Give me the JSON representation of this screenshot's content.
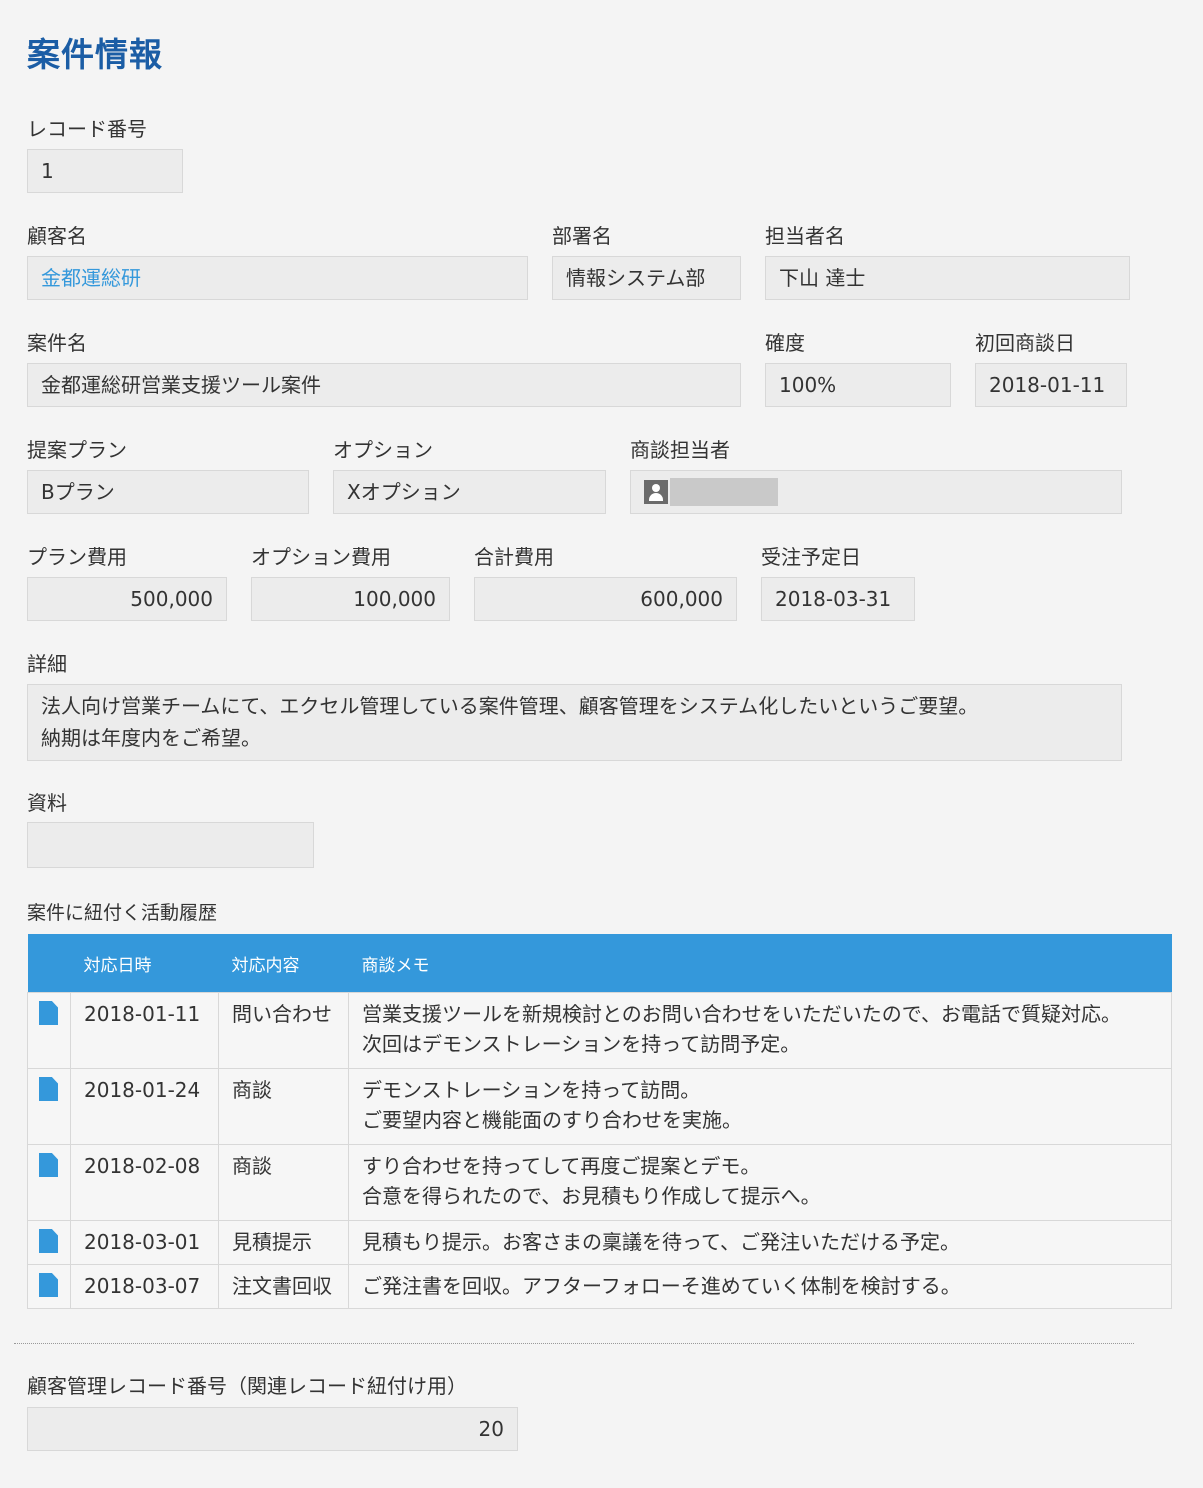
{
  "page_title": "案件情報",
  "record_number": {
    "label": "レコード番号",
    "value": "1"
  },
  "customer_name": {
    "label": "顧客名",
    "value": "金都運総研"
  },
  "department": {
    "label": "部署名",
    "value": "情報システム部"
  },
  "contact_person": {
    "label": "担当者名",
    "value": "下山 達士"
  },
  "project_name": {
    "label": "案件名",
    "value": "金都運総研営業支援ツール案件"
  },
  "certainty": {
    "label": "確度",
    "value": "100%"
  },
  "first_meeting_date": {
    "label": "初回商談日",
    "value": "2018-01-11"
  },
  "proposal_plan": {
    "label": "提案プラン",
    "value": "Bプラン"
  },
  "option": {
    "label": "オプション",
    "value": "Xオプション"
  },
  "sales_rep": {
    "label": "商談担当者",
    "icon": "user-icon"
  },
  "plan_cost": {
    "label": "プラン費用",
    "value": "500,000"
  },
  "option_cost": {
    "label": "オプション費用",
    "value": "100,000"
  },
  "total_cost": {
    "label": "合計費用",
    "value": "600,000"
  },
  "order_date": {
    "label": "受注予定日",
    "value": "2018-03-31"
  },
  "details": {
    "label": "詳細",
    "line1": "法人向け営業チームにて、エクセル管理している案件管理、顧客管理をシステム化したいというご要望。",
    "line2": "納期は年度内をご希望。"
  },
  "materials": {
    "label": "資料",
    "value": ""
  },
  "activity": {
    "label": "案件に紐付く活動履歴",
    "columns": [
      "対応日時",
      "対応内容",
      "商談メモ"
    ],
    "rows": [
      {
        "date": "2018-01-11",
        "type": "問い合わせ",
        "memo1": "営業支援ツールを新規検討とのお問い合わせをいただいたので、お電話で質疑対応。",
        "memo2": "次回はデモンストレーションを持って訪問予定。"
      },
      {
        "date": "2018-01-24",
        "type": "商談",
        "memo1": "デモンストレーションを持って訪問。",
        "memo2": "ご要望内容と機能面のすり合わせを実施。"
      },
      {
        "date": "2018-02-08",
        "type": "商談",
        "memo1": "すり合わせを持ってして再度ご提案とデモ。",
        "memo2": "合意を得られたので、お見積もり作成して提示へ。"
      },
      {
        "date": "2018-03-01",
        "type": "見積提示",
        "memo1": "見積もり提示。お客さまの稟議を待って、ご発注いただける予定。",
        "memo2": ""
      },
      {
        "date": "2018-03-07",
        "type": "注文書回収",
        "memo1": "ご発注書を回収。アフターフォローそ進めていく体制を検討する。",
        "memo2": ""
      }
    ]
  },
  "customer_record_number": {
    "label": "顧客管理レコード番号（関連レコード紐付け用）",
    "value": "20"
  },
  "colors": {
    "title": "#1b5da5",
    "table_header": "#3498db",
    "link": "#3498db"
  }
}
